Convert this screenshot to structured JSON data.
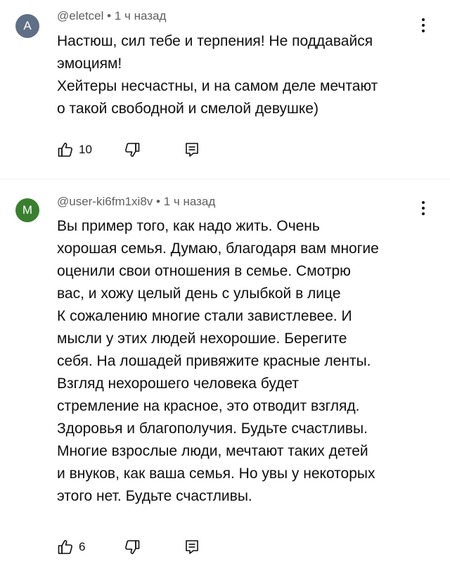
{
  "comments": [
    {
      "avatar_letter": "A",
      "avatar_color": "#5f6f85",
      "author": "@eletcel",
      "separator": "•",
      "time": "1 ч назад",
      "lines": [
        "Настюш, сил тебе и терпения! Не поддавайся",
        "эмоциям!",
        "Хейтеры несчастны, и на самом деле мечтают",
        "о такой свободной и смелой девушке)"
      ],
      "likes": "10"
    },
    {
      "avatar_letter": "M",
      "avatar_color": "#3a7f2f",
      "author": "@user-ki6fm1xi8v",
      "separator": "•",
      "time": "1 ч назад",
      "lines": [
        "Вы пример того, как надо жить. Очень",
        "хорошая семья. Думаю, благодаря вам многие",
        "оценили свои отношения в семье. Смотрю",
        "вас, и хожу целый день с улыбкой в лице",
        "К сожалению многие стали завистлевее. И",
        "мысли у этих людей нехорошие. Берегите",
        "себя. На лошадей привяжите красные ленты.",
        "Взгляд нехорошего человека будет",
        "стремление на красное, это отводит взгляд.",
        "Здоровья и благополучия. Будьте счастливы.",
        "Многие взрослые люди, мечтают таких детей",
        "и внуков, как ваша семья. Но увы у некоторых",
        "этого нет. Будьте счастливы."
      ],
      "likes": "6"
    }
  ],
  "icons": {
    "like": "thumbs-up-icon",
    "dislike": "thumbs-down-icon",
    "reply": "reply-icon",
    "menu": "more-vert-icon"
  }
}
